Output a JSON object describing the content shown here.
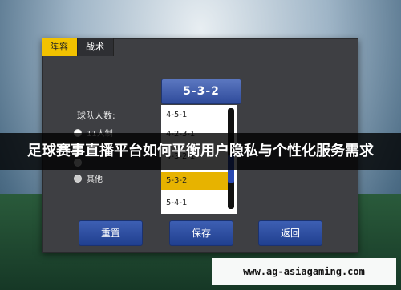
{
  "tabs": [
    {
      "label": "阵容"
    },
    {
      "label": "战术"
    }
  ],
  "formation": {
    "current": "5-3-2"
  },
  "team_size": {
    "label": "球队人数:"
  },
  "radios": [
    {
      "label": "11人制"
    },
    {
      "label": ""
    },
    {
      "label": ""
    },
    {
      "label": "其他"
    }
  ],
  "dropdown": {
    "options": [
      "4-5-1",
      "4-2-3-1",
      "4-3-2-1",
      "5-3-2",
      "5-4-1"
    ],
    "selected_index": 3
  },
  "buttons": {
    "reset": "重置",
    "save": "保存",
    "back": "返回"
  },
  "banner": {
    "text": "足球赛事直播平台如何平衡用户隐私与个性化服务需求"
  },
  "watermark": {
    "url": "www.ag-asiagaming.com"
  },
  "colors": {
    "tab_active": "#f2c200",
    "button_blue": "#2f4b9b",
    "selected_yellow": "#e7b300"
  }
}
